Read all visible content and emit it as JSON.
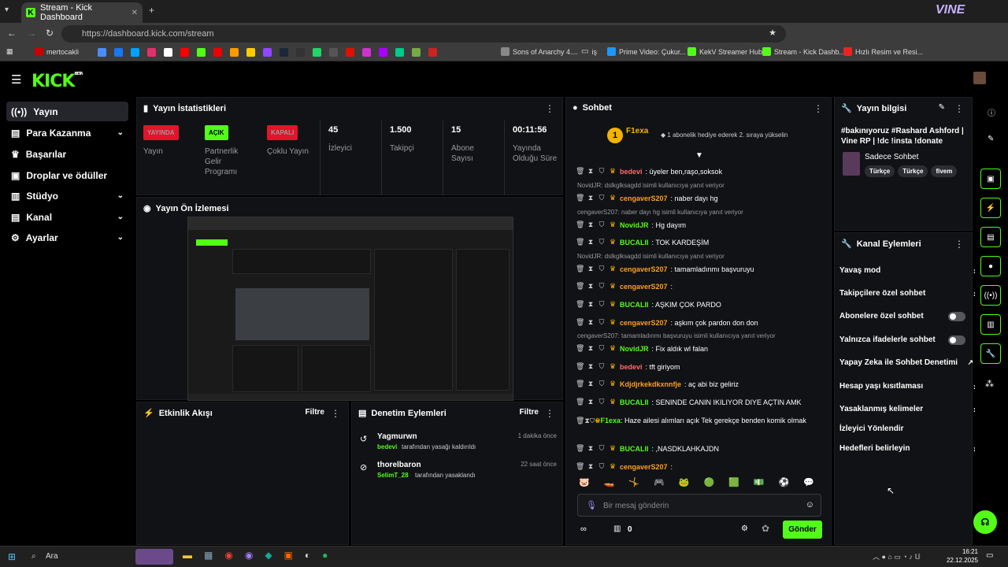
{
  "browser": {
    "tab_title": "Stream - Kick Dashboard",
    "url": "https://dashboard.kick.com/stream",
    "bookmarks": [
      "mertocakli",
      "Sons of Anarchy 4....",
      "iş",
      "Prime Video: Çukur...",
      "KekV Streamer Hub",
      "Stream - Kick Dashb...",
      "Hızlı Resim ve Resi..."
    ]
  },
  "kick": {
    "logo": "KICK",
    "beta": "BETA"
  },
  "sidebar": {
    "items": [
      {
        "label": "Yayın",
        "icon": "broadcast-icon"
      },
      {
        "label": "Para Kazanma",
        "icon": "money-icon"
      },
      {
        "label": "Başarılar",
        "icon": "trophy-icon"
      },
      {
        "label": "Droplar ve ödüller",
        "icon": "gift-icon"
      },
      {
        "label": "Stüdyo",
        "icon": "studio-icon"
      },
      {
        "label": "Kanal",
        "icon": "channel-icon"
      },
      {
        "label": "Ayarlar",
        "icon": "gear-icon"
      }
    ]
  },
  "stats": {
    "title": "Yayın İstatistikleri",
    "badges": {
      "live": "YAYINDA",
      "on": "AÇIK",
      "off": "KAPALI"
    },
    "badge_labels": {
      "live": "Yayın",
      "on": "Partnerlik Gelir Programı",
      "off": "Çoklu Yayın"
    },
    "viewers_value": "45",
    "viewers_label": "İzleyici",
    "followers_value": "1.500",
    "followers_label": "Takipçi",
    "subs_value": "15",
    "subs_label": "Abone Sayısı",
    "uptime_value": "00:11:56",
    "uptime_label": "Yayında Olduğu Süre"
  },
  "preview": {
    "title": "Yayın Ön İzlemesi"
  },
  "activity": {
    "title": "Etkinlik Akışı",
    "filter": "Filtre"
  },
  "moderation": {
    "title": "Denetim Eylemleri",
    "filter": "Filtre",
    "entries": [
      {
        "user": "Yagmurwn",
        "time": "1 dakika önce",
        "target": "bedevi",
        "action": "tarafından yasağı kaldırıldı"
      },
      {
        "user": "thorelbaron",
        "time": "22 saat önce",
        "target": "SelimT_28",
        "action": "tarafından yasaklandı"
      }
    ]
  },
  "chat": {
    "title": "Sohbet",
    "gift_user": "F1exa",
    "gift_text": "1 abonelik hediye ederek 2. sıraya yükselin",
    "gift_rank": "1",
    "input_placeholder": "Bir mesaj gönderin",
    "send": "Gönder",
    "points": "0",
    "messages": [
      {
        "reply": "",
        "user": "bedevi",
        "color": "#ff6b6b",
        "text": ": üyeler ben,raşo,soksok"
      },
      {
        "reply": "NovidJR: dslkglksagdd isimli kullanıcıya yanıt veriyor",
        "user": "cengaverS207",
        "color": "#ff9f1a",
        "text": ": naber dayı hg"
      },
      {
        "reply": "cengaverS207: naber dayı hg isimli kullanıcıya yanıt veriyor",
        "user": "NovidJR",
        "color": "#53fc18",
        "text": ": Hg dayım"
      },
      {
        "reply": "",
        "user": "BUCALII",
        "color": "#53fc18",
        "text": ": TOK KARDEŞİM"
      },
      {
        "reply": "NovidJR: dslkglksagdd isimli kullanıcıya yanıt veriyor",
        "user": "cengaverS207",
        "color": "#ff9f1a",
        "text": ": tamamladınmı başvuruyu"
      },
      {
        "reply": "",
        "user": "cengaverS207",
        "color": "#ff9f1a",
        "text": ":"
      },
      {
        "reply": "",
        "user": "BUCALII",
        "color": "#53fc18",
        "text": ": AŞKIM ÇOK PARDO"
      },
      {
        "reply": "",
        "user": "cengaverS207",
        "color": "#ff9f1a",
        "text": ": aşkım çok pardon don don"
      },
      {
        "reply": "cengaverS207: tamamladınmı başvuruyu isimli kullanıcıya yanıt veriyor",
        "user": "NovidJR",
        "color": "#53fc18",
        "text": ": Fix aldık wl falan"
      },
      {
        "reply": "",
        "user": "bedevi",
        "color": "#ff6b6b",
        "text": ": tft giriyom"
      },
      {
        "reply": "",
        "user": "Kdjdjrkekdkxnnfje",
        "color": "#ff9f1a",
        "text": ": aç abi biz geliriz"
      },
      {
        "reply": "",
        "user": "BUCALII",
        "color": "#53fc18",
        "text": ": SENINDE CANIN IKILIYOR DIYE AÇTIN AMK"
      },
      {
        "reply": "",
        "user": "F1exa",
        "color": "#53fc18",
        "text": ": Haze ailesi alımları açık Tek gerekçe benden komik olmak"
      },
      {
        "reply": "",
        "user": "BUCALII",
        "color": "#53fc18",
        "text": ": ,NASDKLAHKAJDN"
      },
      {
        "reply": "",
        "user": "cengaverS207",
        "color": "#ff9f1a",
        "text": ":"
      }
    ]
  },
  "stream_info": {
    "title": "Yayın bilgisi",
    "stream_title": "#bakınıyoruz #Rashard Ashford | Vine RP | !dc !insta !donate",
    "category": "Sadece Sohbet",
    "tags": [
      "Türkçe",
      "Türkçe",
      "fivem"
    ]
  },
  "channel_actions": {
    "title": "Kanal Eylemleri",
    "items": [
      {
        "label": "Yavaş mod",
        "kind": "arrow"
      },
      {
        "label": "Takipçilere özel sohbet",
        "kind": "arrow"
      },
      {
        "label": "Abonelere özel sohbet",
        "kind": "toggle"
      },
      {
        "label": "Yalnızca ifadelerle sohbet",
        "kind": "toggle"
      },
      {
        "label": "Yapay Zeka ile Sohbet Denetimi",
        "kind": "external"
      },
      {
        "label": "Hesap yaşı kısıtlaması",
        "kind": "arrow"
      },
      {
        "label": "Yasaklanmış kelimeler",
        "kind": "arrow"
      },
      {
        "label": "İzleyici Yönlendir",
        "kind": "none"
      },
      {
        "label": "Hedefleri belirleyin",
        "kind": "arrow"
      }
    ]
  },
  "taskbar": {
    "search": "Ara",
    "time": "16:21",
    "date": "22.12.2025"
  }
}
